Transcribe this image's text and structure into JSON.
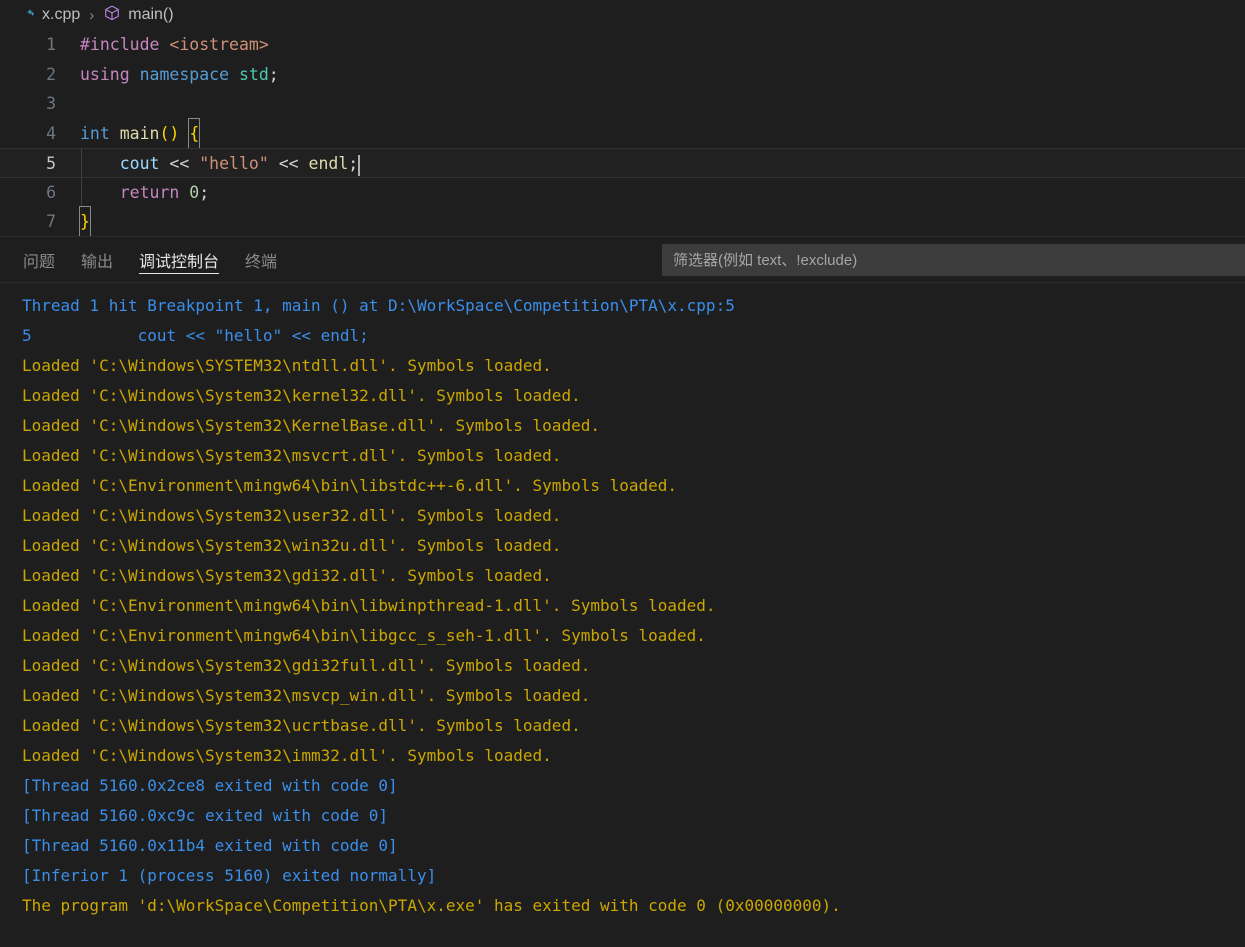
{
  "breadcrumb": {
    "file_icon": "cpp-file-icon",
    "file": "x.cpp",
    "separator": "›",
    "symbol_icon": "symbol-method-cube-icon",
    "symbol": "main()"
  },
  "editor": {
    "language": "cpp",
    "cursor_line": 5,
    "lines": [
      {
        "number": "1",
        "text": "#include <iostream>"
      },
      {
        "number": "2",
        "text": "using namespace std;"
      },
      {
        "number": "3",
        "text": ""
      },
      {
        "number": "4",
        "text": "int main() {"
      },
      {
        "number": "5",
        "text": "    cout << \"hello\" << endl;"
      },
      {
        "number": "6",
        "text": "    return 0;"
      },
      {
        "number": "7",
        "text": "}"
      }
    ],
    "tokens": {
      "l1_include": "#include",
      "l1_header": "<iostream>",
      "l2_using": "using",
      "l2_namespace": "namespace",
      "l2_std": "std",
      "l2_semi": ";",
      "l4_int": "int",
      "l4_main": "main",
      "l4_parens": "()",
      "l4_brace": "{",
      "l5_indent": "    ",
      "l5_cout": "cout",
      "l5_op1": " << ",
      "l5_str": "\"hello\"",
      "l5_op2": " << ",
      "l5_endl": "endl",
      "l5_semi": ";",
      "l6_indent": "    ",
      "l6_return": "return",
      "l6_space": " ",
      "l6_zero": "0",
      "l6_semi": ";",
      "l7_brace": "}"
    }
  },
  "panel": {
    "tabs": [
      {
        "label": "问题",
        "active": false
      },
      {
        "label": "输出",
        "active": false
      },
      {
        "label": "调试控制台",
        "active": true
      },
      {
        "label": "终端",
        "active": false
      }
    ],
    "filter": {
      "value": "",
      "placeholder": "筛选器(例如 text、!exclude)"
    },
    "console_lines": [
      {
        "text": "Thread 1 hit Breakpoint 1, main () at D:\\WorkSpace\\Competition\\PTA\\x.cpp:5",
        "color": "blue"
      },
      {
        "text": "5           cout << \"hello\" << endl;",
        "color": "blue"
      },
      {
        "text": "Loaded 'C:\\Windows\\SYSTEM32\\ntdll.dll'. Symbols loaded.",
        "color": "yellow"
      },
      {
        "text": "Loaded 'C:\\Windows\\System32\\kernel32.dll'. Symbols loaded.",
        "color": "yellow"
      },
      {
        "text": "Loaded 'C:\\Windows\\System32\\KernelBase.dll'. Symbols loaded.",
        "color": "yellow"
      },
      {
        "text": "Loaded 'C:\\Windows\\System32\\msvcrt.dll'. Symbols loaded.",
        "color": "yellow"
      },
      {
        "text": "Loaded 'C:\\Environment\\mingw64\\bin\\libstdc++-6.dll'. Symbols loaded.",
        "color": "yellow"
      },
      {
        "text": "Loaded 'C:\\Windows\\System32\\user32.dll'. Symbols loaded.",
        "color": "yellow"
      },
      {
        "text": "Loaded 'C:\\Windows\\System32\\win32u.dll'. Symbols loaded.",
        "color": "yellow"
      },
      {
        "text": "Loaded 'C:\\Windows\\System32\\gdi32.dll'. Symbols loaded.",
        "color": "yellow"
      },
      {
        "text": "Loaded 'C:\\Environment\\mingw64\\bin\\libwinpthread-1.dll'. Symbols loaded.",
        "color": "yellow"
      },
      {
        "text": "Loaded 'C:\\Environment\\mingw64\\bin\\libgcc_s_seh-1.dll'. Symbols loaded.",
        "color": "yellow"
      },
      {
        "text": "Loaded 'C:\\Windows\\System32\\gdi32full.dll'. Symbols loaded.",
        "color": "yellow"
      },
      {
        "text": "Loaded 'C:\\Windows\\System32\\msvcp_win.dll'. Symbols loaded.",
        "color": "yellow"
      },
      {
        "text": "Loaded 'C:\\Windows\\System32\\ucrtbase.dll'. Symbols loaded.",
        "color": "yellow"
      },
      {
        "text": "Loaded 'C:\\Windows\\System32\\imm32.dll'. Symbols loaded.",
        "color": "yellow"
      },
      {
        "text": "[Thread 5160.0x2ce8 exited with code 0]",
        "color": "blue"
      },
      {
        "text": "[Thread 5160.0xc9c exited with code 0]",
        "color": "blue"
      },
      {
        "text": "[Thread 5160.0x11b4 exited with code 0]",
        "color": "blue"
      },
      {
        "text": "[Inferior 1 (process 5160) exited normally]",
        "color": "blue"
      },
      {
        "text": "The program 'd:\\WorkSpace\\Competition\\PTA\\x.exe' has exited with code 0 (0x00000000).",
        "color": "yellow"
      }
    ]
  },
  "colors": {
    "editor_bg": "#1e1e1e",
    "panel_bg": "#1e1e1e",
    "accent_blue": "#3b8eea",
    "warning_yellow": "#cca700",
    "active_line_bg": "#212121",
    "filter_bg": "#3c3c3c"
  }
}
